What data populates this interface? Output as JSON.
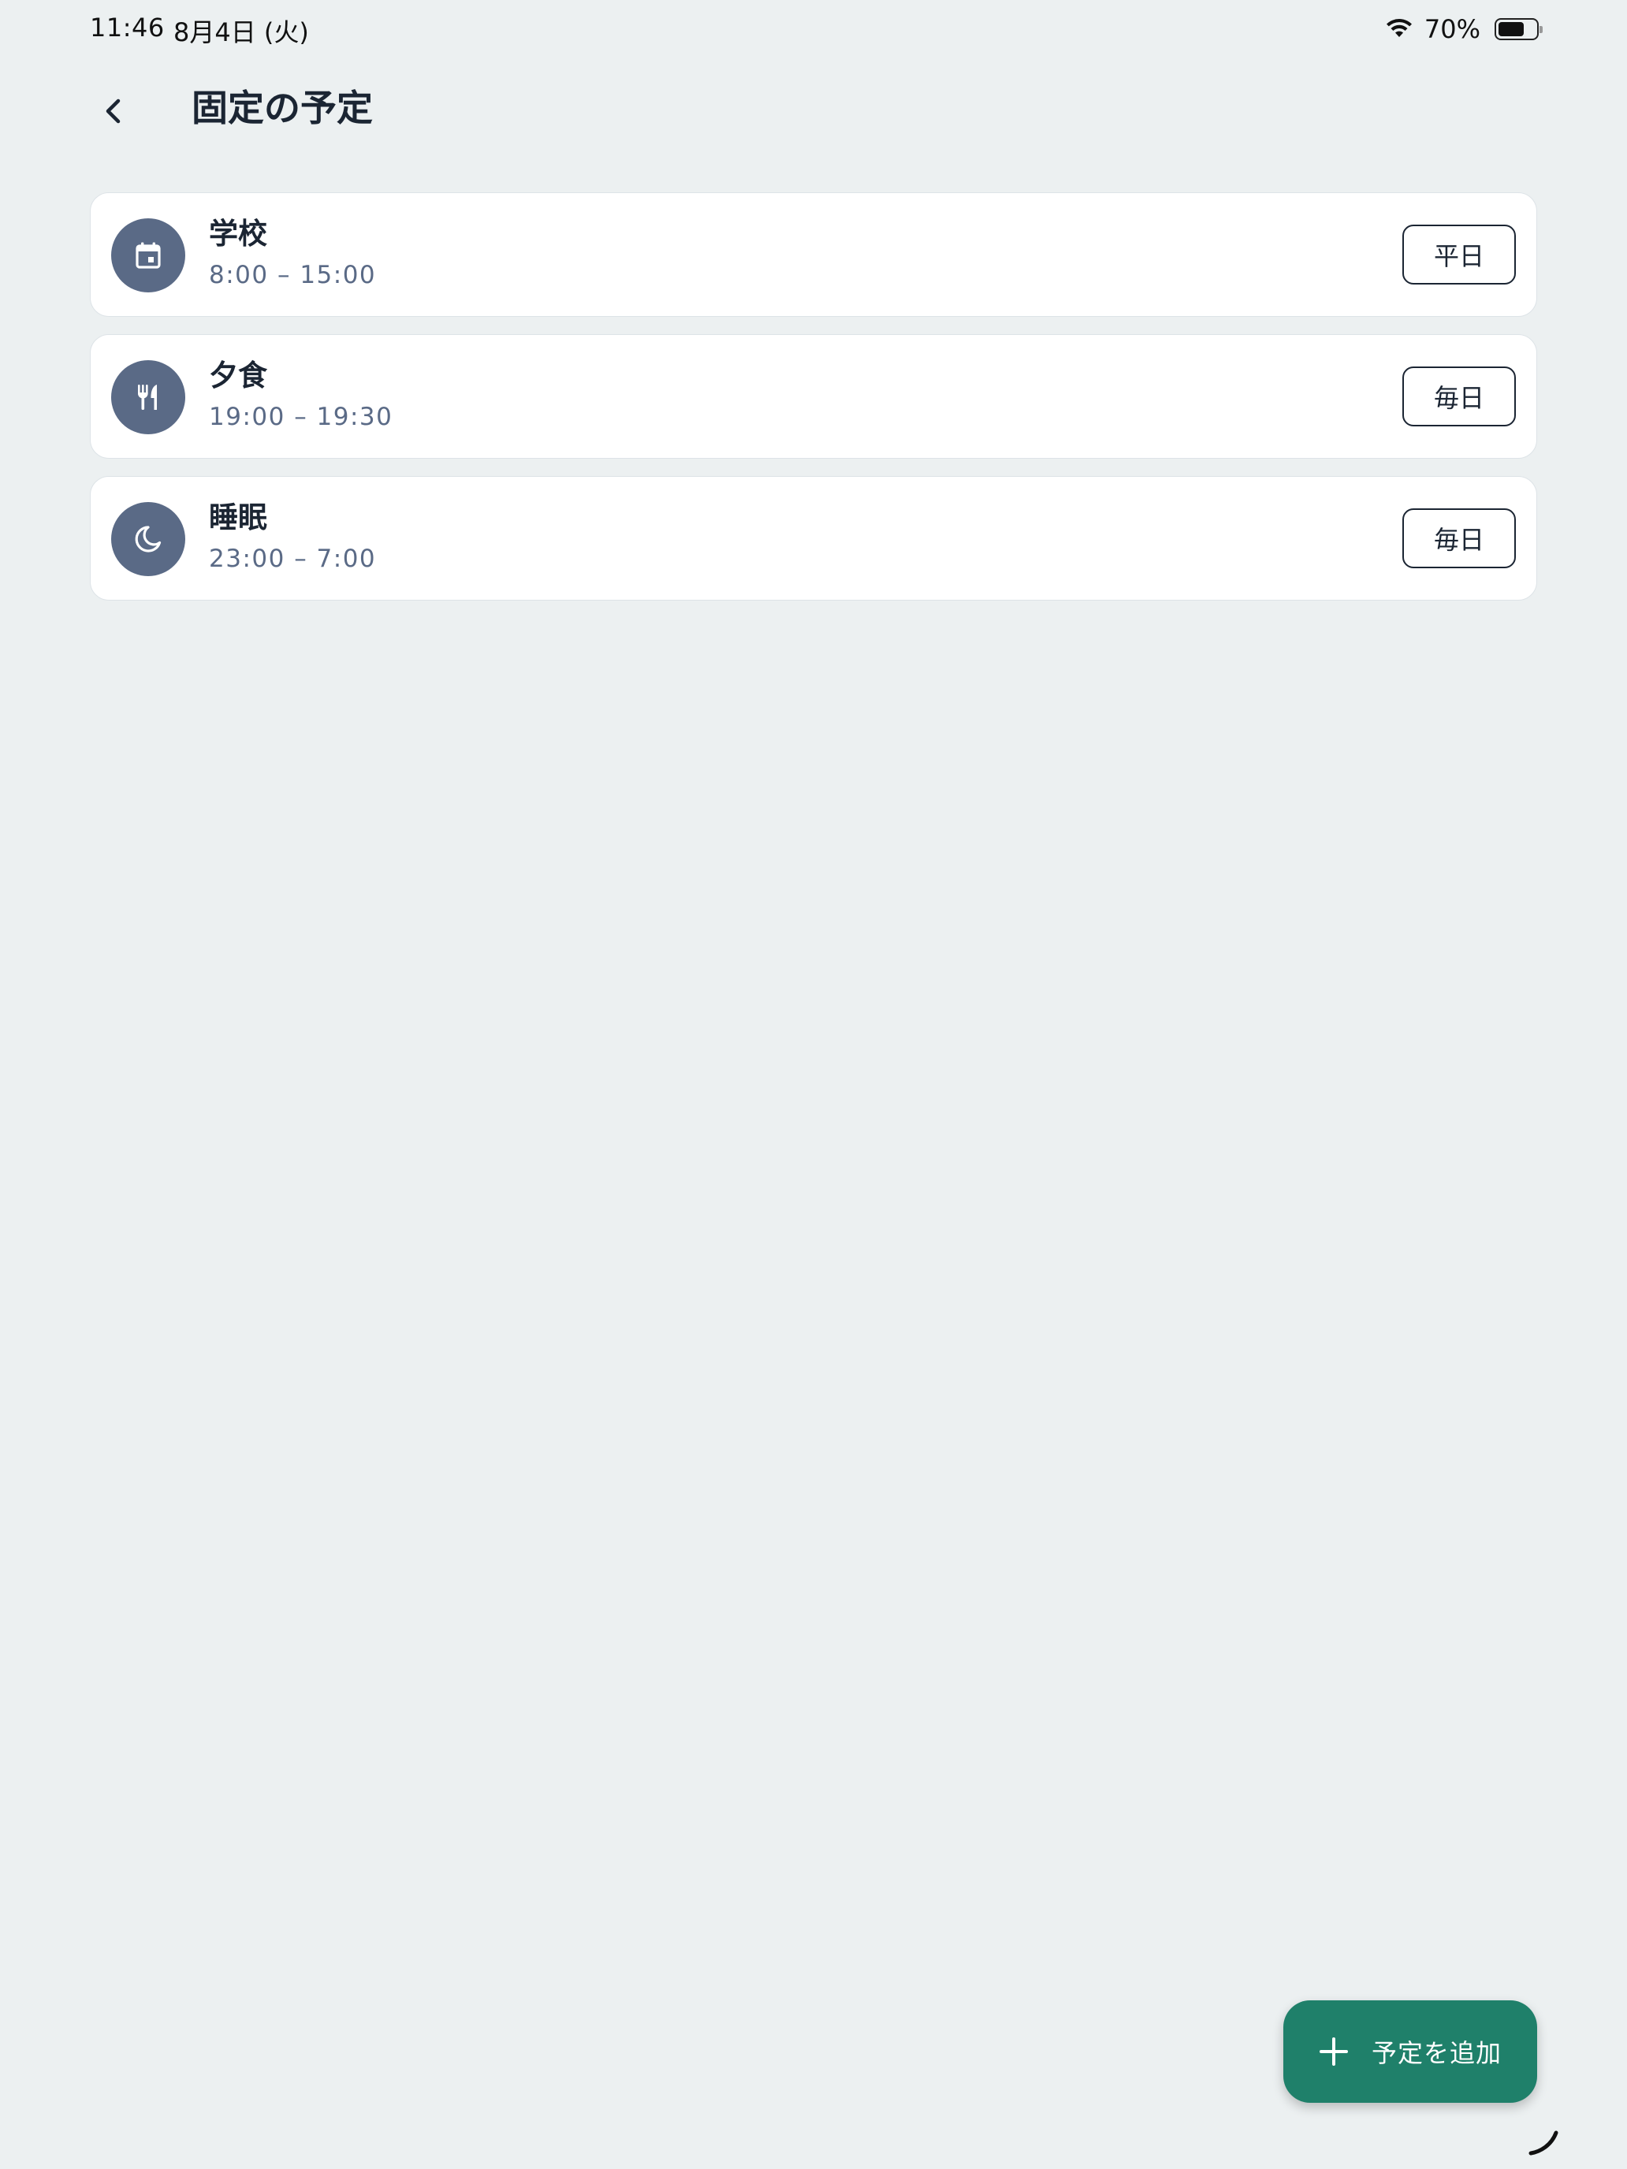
{
  "status_bar": {
    "time": "11:46",
    "date": "8月4日 (火)",
    "battery_percent": "70%",
    "battery_level": 0.7,
    "wifi_icon": "wifi-icon",
    "battery_icon": "battery-icon"
  },
  "header": {
    "back_icon": "chevron-left-icon",
    "title": "固定の予定"
  },
  "schedules": [
    {
      "icon": "calendar-icon",
      "name": "学校",
      "time": "8:00 – 15:00",
      "repeat": "平日"
    },
    {
      "icon": "utensils-icon",
      "name": "夕食",
      "time": "19:00 – 19:30",
      "repeat": "毎日"
    },
    {
      "icon": "moon-icon",
      "name": "睡眠",
      "time": "23:00 – 7:00",
      "repeat": "毎日"
    }
  ],
  "fab": {
    "icon": "plus-icon",
    "label": "予定を追加"
  },
  "colors": {
    "background": "#ECF0F1",
    "card": "#FFFFFF",
    "icon_circle": "#5A6A86",
    "text_primary": "#1B2533",
    "text_secondary": "#5A6A86",
    "accent": "#1F806A"
  }
}
